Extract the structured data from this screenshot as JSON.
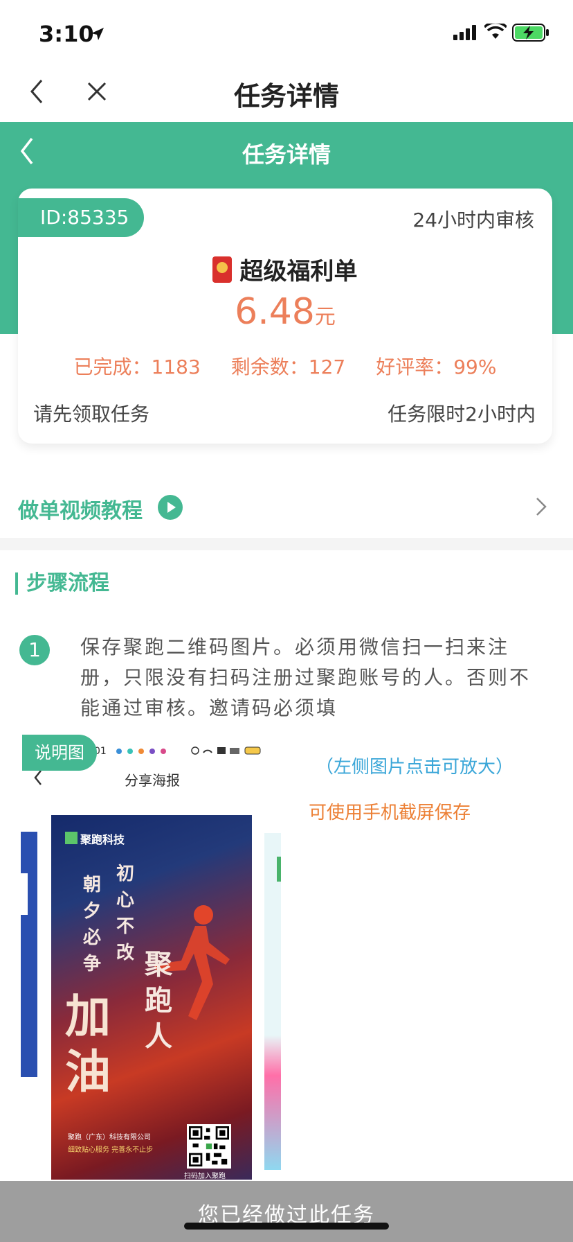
{
  "status_bar": {
    "time": "3:10"
  },
  "outer_nav": {
    "title": "任务详情"
  },
  "inner_nav": {
    "title": "任务详情"
  },
  "task": {
    "id": "ID:85335",
    "review": "24小时内审核",
    "title": "超级福利单",
    "price": "6.48",
    "unit": "元",
    "completed": "已完成：1183",
    "remaining": "剩余数：127",
    "rating": "好评率：99%",
    "claim_hint": "请先领取任务",
    "time_limit": "任务限时2小时内"
  },
  "video": {
    "label": "做单视频教程"
  },
  "steps": {
    "heading": "步骤流程",
    "items": [
      {
        "num": "1",
        "text": "保存聚跑二维码图片。必须用微信扫一扫来注册，只限没有扫码注册过聚跑账号的人。否则不能通过审核。邀请码必须填"
      }
    ]
  },
  "illustration": {
    "badge": "说明图",
    "enlarge_hint": "（左侧图片点击可放大）",
    "save_hint": "可使用手机截屏保存",
    "screenshot": {
      "status_time": "01",
      "title": "分享海报"
    },
    "poster": {
      "brand": "聚跑科技",
      "col1": "朝夕必争",
      "col2": "初心不改",
      "big_left": "加油",
      "big_right": "聚跑人",
      "company": "聚跑（广东）科技有限公司",
      "slogan": "细致贴心服务 完善永不止步",
      "qr_label": "扫码加入聚跑"
    }
  },
  "bottom": {
    "text": "您已经做过此任务"
  },
  "colors": {
    "brand_green": "#44b892",
    "accent_orange": "#ec7f5a",
    "hint_blue": "#3aa6d8",
    "bar_gray": "#9e9e9e"
  }
}
